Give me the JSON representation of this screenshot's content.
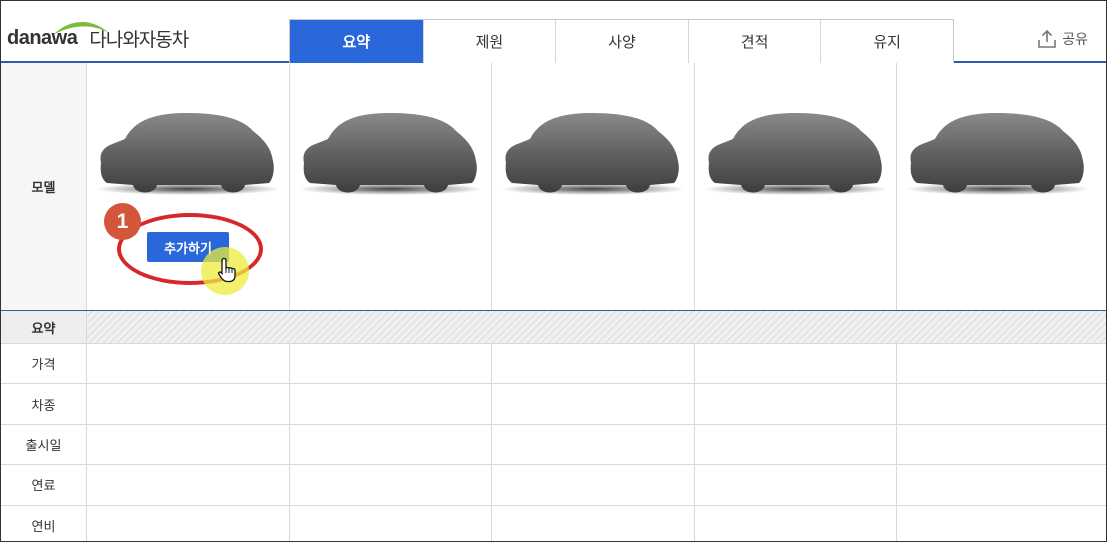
{
  "header": {
    "logo_en": "danawa",
    "logo_ko": "다나와자동차",
    "tabs": [
      {
        "label": "요약",
        "active": true
      },
      {
        "label": "제원",
        "active": false
      },
      {
        "label": "사양",
        "active": false
      },
      {
        "label": "견적",
        "active": false
      },
      {
        "label": "유지",
        "active": false
      }
    ],
    "share_label": "공유"
  },
  "model_row": {
    "label": "모델",
    "slots": [
      {
        "add_label": "추가하기"
      },
      {},
      {},
      {},
      {}
    ]
  },
  "section": {
    "title": "요약"
  },
  "rows": [
    {
      "label": "가격"
    },
    {
      "label": "차종"
    },
    {
      "label": "출시일"
    },
    {
      "label": "연료"
    },
    {
      "label": "연비"
    }
  ],
  "annotation": {
    "step_number": "1",
    "highlight_color": "#d62828",
    "badge_color": "#d4563a"
  },
  "colors": {
    "accent": "#2a67db",
    "header_rule": "#2a5db0"
  }
}
